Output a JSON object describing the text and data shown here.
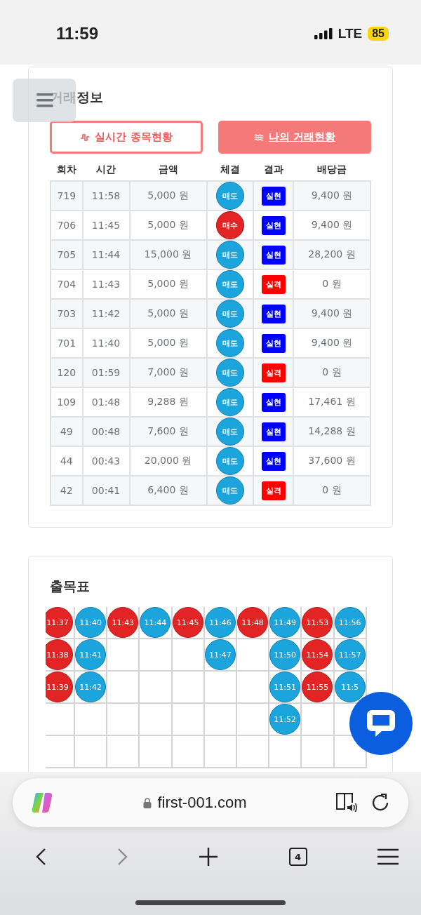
{
  "status_bar": {
    "time": "11:59",
    "network": "LTE",
    "battery": "85"
  },
  "trade_card": {
    "title": "거래정보",
    "tabs": [
      {
        "label": "실시간 종목현황",
        "selected": false,
        "kind": "pulse"
      },
      {
        "label": "나의 거래현황",
        "selected": true,
        "kind": "waves"
      }
    ],
    "columns": [
      "회차",
      "시간",
      "금액",
      "체결",
      "결과",
      "배당금"
    ],
    "rows": [
      {
        "round": "719",
        "time": "11:58",
        "amount": "5,000 원",
        "trade": {
          "label": "매도",
          "kind": "sell"
        },
        "result": {
          "label": "실현",
          "kind": "win"
        },
        "payout": "9,400 원"
      },
      {
        "round": "706",
        "time": "11:45",
        "amount": "5,000 원",
        "trade": {
          "label": "매수",
          "kind": "buy"
        },
        "result": {
          "label": "실현",
          "kind": "win"
        },
        "payout": "9,400 원"
      },
      {
        "round": "705",
        "time": "11:44",
        "amount": "15,000 원",
        "trade": {
          "label": "매도",
          "kind": "sell"
        },
        "result": {
          "label": "실현",
          "kind": "win"
        },
        "payout": "28,200 원"
      },
      {
        "round": "704",
        "time": "11:43",
        "amount": "5,000 원",
        "trade": {
          "label": "매도",
          "kind": "sell"
        },
        "result": {
          "label": "실격",
          "kind": "lose"
        },
        "payout": "0 원"
      },
      {
        "round": "703",
        "time": "11:42",
        "amount": "5,000 원",
        "trade": {
          "label": "매도",
          "kind": "sell"
        },
        "result": {
          "label": "실현",
          "kind": "win"
        },
        "payout": "9,400 원"
      },
      {
        "round": "701",
        "time": "11:40",
        "amount": "5,000 원",
        "trade": {
          "label": "매도",
          "kind": "sell"
        },
        "result": {
          "label": "실현",
          "kind": "win"
        },
        "payout": "9,400 원"
      },
      {
        "round": "120",
        "time": "01:59",
        "amount": "7,000 원",
        "trade": {
          "label": "매도",
          "kind": "sell"
        },
        "result": {
          "label": "실격",
          "kind": "lose"
        },
        "payout": "0 원"
      },
      {
        "round": "109",
        "time": "01:48",
        "amount": "9,288 원",
        "trade": {
          "label": "매도",
          "kind": "sell"
        },
        "result": {
          "label": "실현",
          "kind": "win"
        },
        "payout": "17,461 원"
      },
      {
        "round": "49",
        "time": "00:48",
        "amount": "7,600 원",
        "trade": {
          "label": "매도",
          "kind": "sell"
        },
        "result": {
          "label": "실현",
          "kind": "win"
        },
        "payout": "14,288 원"
      },
      {
        "round": "44",
        "time": "00:43",
        "amount": "20,000 원",
        "trade": {
          "label": "매도",
          "kind": "sell"
        },
        "result": {
          "label": "실현",
          "kind": "win"
        },
        "payout": "37,600 원"
      },
      {
        "round": "42",
        "time": "00:41",
        "amount": "6,400 원",
        "trade": {
          "label": "매도",
          "kind": "sell"
        },
        "result": {
          "label": "실격",
          "kind": "lose"
        },
        "payout": "0 원"
      }
    ]
  },
  "chart_card": {
    "title": "출목표",
    "columns": [
      [
        {
          "time": "11:37",
          "kind": "buy"
        },
        {
          "time": "11:38",
          "kind": "buy"
        },
        {
          "time": "11:39",
          "kind": "buy"
        }
      ],
      [
        {
          "time": "11:40",
          "kind": "sell"
        },
        {
          "time": "11:41",
          "kind": "sell"
        },
        {
          "time": "11:42",
          "kind": "sell"
        }
      ],
      [
        {
          "time": "11:43",
          "kind": "buy"
        }
      ],
      [
        {
          "time": "11:44",
          "kind": "sell"
        }
      ],
      [
        {
          "time": "11:45",
          "kind": "buy"
        }
      ],
      [
        {
          "time": "11:46",
          "kind": "sell"
        },
        {
          "time": "11:47",
          "kind": "sell"
        }
      ],
      [
        {
          "time": "11:48",
          "kind": "buy"
        }
      ],
      [
        {
          "time": "11:49",
          "kind": "sell"
        },
        {
          "time": "11:50",
          "kind": "sell"
        },
        {
          "time": "11:51",
          "kind": "sell"
        },
        {
          "time": "11:52",
          "kind": "sell"
        }
      ],
      [
        {
          "time": "11:53",
          "kind": "buy"
        },
        {
          "time": "11:54",
          "kind": "buy"
        },
        {
          "time": "11:55",
          "kind": "buy"
        }
      ],
      [
        {
          "time": "11:56",
          "kind": "sell"
        },
        {
          "time": "11:57",
          "kind": "sell"
        },
        {
          "time": "11:5",
          "kind": "sell"
        }
      ]
    ]
  },
  "browser": {
    "url": "first-001.com",
    "tab_count": "4"
  }
}
